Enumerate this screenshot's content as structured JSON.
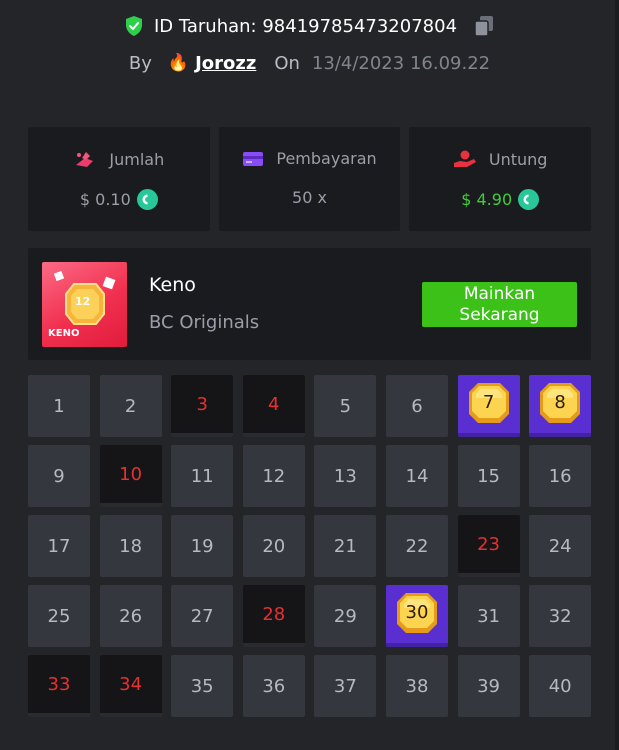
{
  "header": {
    "bet_id": "ID Taruhan: 98419785473207804",
    "by_label": "By",
    "user_icon": "flame-icon",
    "username": "Jorozz",
    "on_label": "On",
    "date": "13/4/2023 16.09.22"
  },
  "stats": [
    {
      "label": "Jumlah",
      "value": "$ 0.10",
      "icon": "bet-amount-icon",
      "coin": true
    },
    {
      "label": "Pembayaran",
      "value": "50 x",
      "icon": "card-icon",
      "coin": false
    },
    {
      "label": "Untung",
      "value": "$ 4.90",
      "icon": "profit-hand-icon",
      "coin": true
    }
  ],
  "game": {
    "title": "Keno",
    "subtitle": "BC Originals",
    "thumb_label": "KENO",
    "thumb_number": "12",
    "play_label": "Mainkan Sekarang"
  },
  "grid": {
    "numbers": [
      1,
      2,
      3,
      4,
      5,
      6,
      7,
      8,
      9,
      10,
      11,
      12,
      13,
      14,
      15,
      16,
      17,
      18,
      19,
      20,
      21,
      22,
      23,
      24,
      25,
      26,
      27,
      28,
      29,
      30,
      31,
      32,
      33,
      34,
      35,
      36,
      37,
      38,
      39,
      40
    ],
    "hits": [
      7,
      8,
      30
    ],
    "misses": [
      3,
      4,
      10,
      23,
      28,
      33,
      34
    ]
  },
  "colors": {
    "profit": "#3fce37",
    "miss_text": "#e53030",
    "hit_bg": "#5a2fd2",
    "play_button": "#3bc117",
    "coin": "#27c79a"
  }
}
